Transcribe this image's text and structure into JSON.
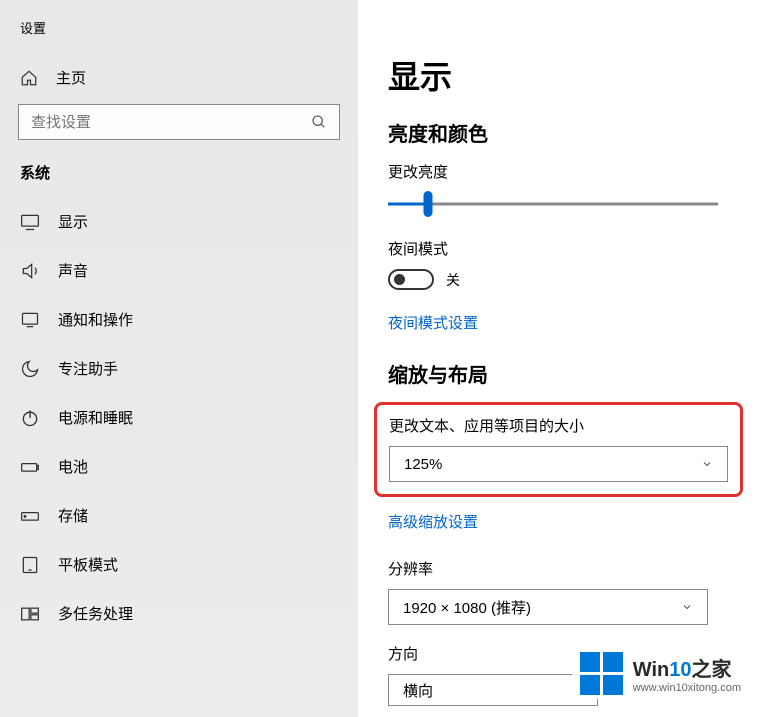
{
  "app_title": "设置",
  "home_label": "主页",
  "search": {
    "placeholder": "查找设置"
  },
  "category_title": "系统",
  "sidebar_items": [
    {
      "label": "显示"
    },
    {
      "label": "声音"
    },
    {
      "label": "通知和操作"
    },
    {
      "label": "专注助手"
    },
    {
      "label": "电源和睡眠"
    },
    {
      "label": "电池"
    },
    {
      "label": "存储"
    },
    {
      "label": "平板模式"
    },
    {
      "label": "多任务处理"
    }
  ],
  "content": {
    "page_title": "显示",
    "brightness_section": "亮度和颜色",
    "brightness_label": "更改亮度",
    "night_mode_label": "夜间模式",
    "toggle_off": "关",
    "night_mode_link": "夜间模式设置",
    "scale_section": "缩放与布局",
    "scale_label": "更改文本、应用等项目的大小",
    "scale_value": "125%",
    "advanced_scale_link": "高级缩放设置",
    "resolution_label": "分辨率",
    "resolution_value": "1920 × 1080 (推荐)",
    "orientation_label": "方向",
    "orientation_value": "横向"
  },
  "watermark": {
    "brand1": "Win",
    "brand2": "10",
    "brand3": "之家",
    "url": "www.win10xitong.com"
  }
}
